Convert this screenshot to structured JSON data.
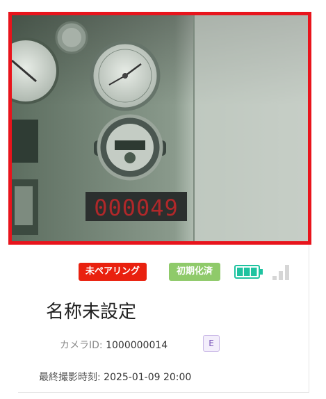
{
  "camera_card": {
    "name": "名称未設定",
    "status": {
      "pairing_label": "未ペアリング",
      "init_label": "初期化済",
      "pairing_color": "#e9210f",
      "init_color": "#8fca6a",
      "battery_level": 1.0,
      "battery_color": "#1ec3a0",
      "signal_level": 0,
      "signal_bars": 3
    },
    "camera_id_label": "カメラID:",
    "camera_id_value": "1000000014",
    "edition_badge": "E",
    "last_shot_label": "最終撮影時刻:",
    "last_shot_value": "2025-01-09 20:00",
    "photo": {
      "counter_display": "000049",
      "frame_color": "#e8141c"
    }
  }
}
